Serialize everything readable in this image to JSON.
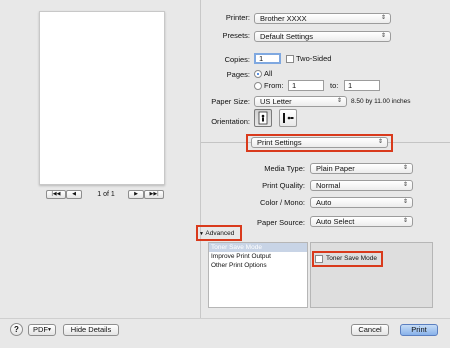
{
  "printer": {
    "label": "Printer:",
    "value": "Brother XXXX"
  },
  "presets": {
    "label": "Presets:",
    "value": "Default Settings"
  },
  "copies": {
    "label": "Copies:",
    "value": "1",
    "two_sided": "Two-Sided"
  },
  "pages": {
    "label": "Pages:",
    "all": "All",
    "from_label": "From:",
    "from_value": "1",
    "to_label": "to:",
    "to_value": "1"
  },
  "paper_size": {
    "label": "Paper Size:",
    "value": "US Letter",
    "dimensions": "8.50 by 11.00 inches"
  },
  "orientation": {
    "label": "Orientation:"
  },
  "section_popup": {
    "value": "Print Settings"
  },
  "media_type": {
    "label": "Media Type:",
    "value": "Plain Paper"
  },
  "print_quality": {
    "label": "Print Quality:",
    "value": "Normal"
  },
  "color_mono": {
    "label": "Color / Mono:",
    "value": "Auto"
  },
  "paper_source": {
    "label": "Paper Source:",
    "value": "Auto Select"
  },
  "advanced": {
    "label": "Advanced",
    "items": [
      "Toner Save Mode",
      "Improve Print Output",
      "Other Print Options"
    ],
    "selected_index": 0,
    "toner_save_label": "Toner Save Mode"
  },
  "preview_nav": {
    "page_text": "1 of 1",
    "first": "|◀◀",
    "prev": "◀",
    "next": "▶",
    "last": "▶▶|"
  },
  "footer": {
    "help": "?",
    "pdf": "PDF",
    "hide_details": "Hide Details",
    "cancel": "Cancel",
    "print": "Print"
  },
  "colors": {
    "highlight": "#d93a1c",
    "accent": "#2a6fd8"
  }
}
